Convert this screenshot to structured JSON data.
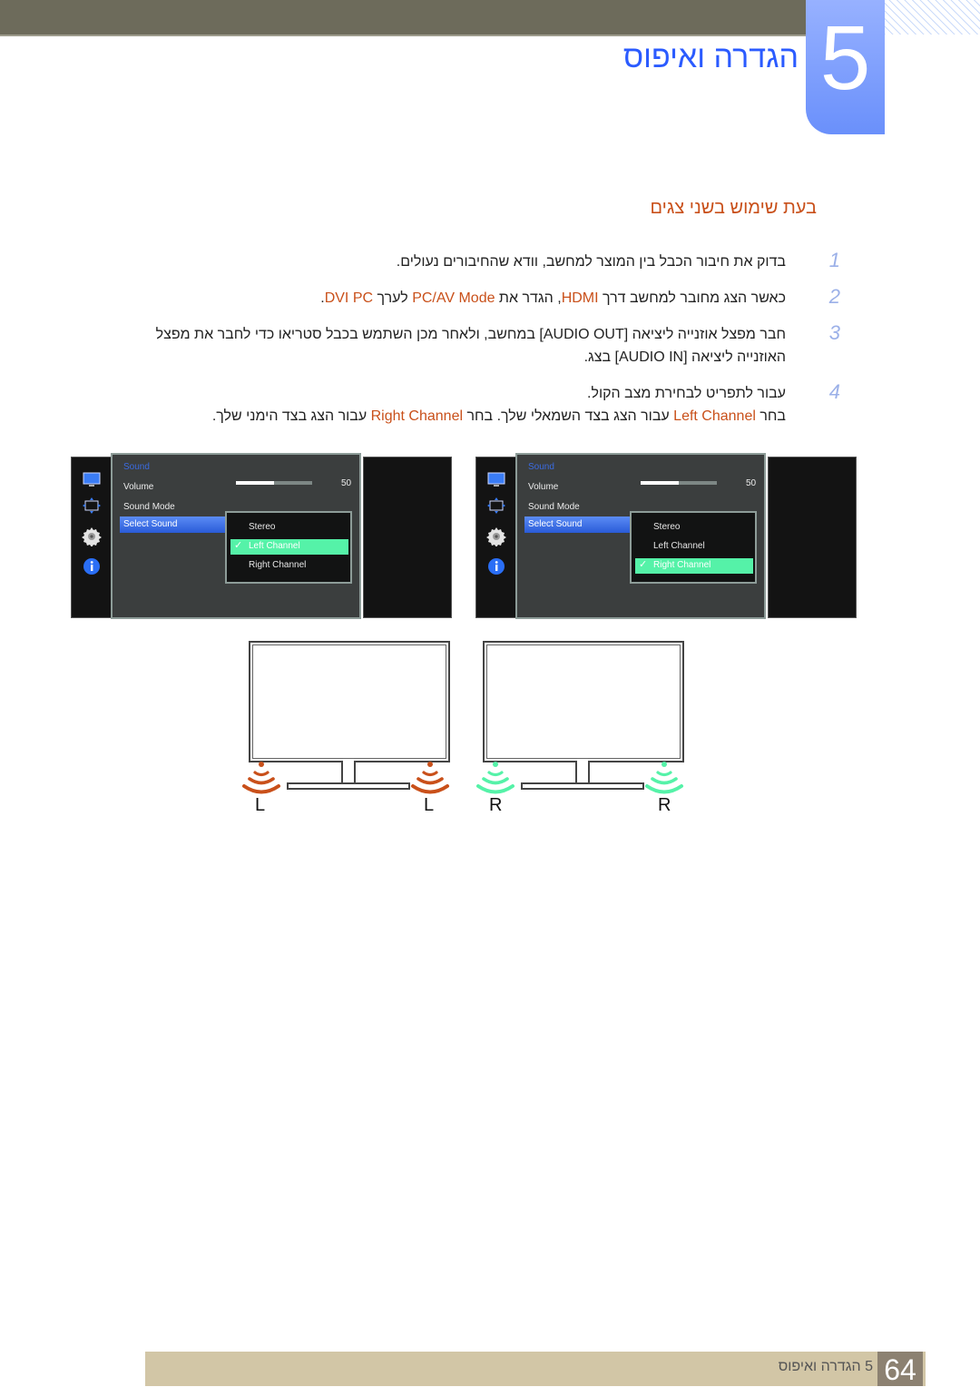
{
  "header": {
    "chapter_number": "5",
    "chapter_title": "הגדרה ואיפוס"
  },
  "section": {
    "title": "בעת שימוש בשני צגים"
  },
  "steps": [
    {
      "num": "1",
      "text": "בדוק את חיבור הכבל בין המוצר למחשב, וודא שהחיבורים נעולים."
    },
    {
      "num": "2",
      "parts": [
        "כאשר הצג מחובר למחשב דרך ",
        "HDMI",
        ", הגדר את ",
        "PC/AV Mode",
        " לערך ",
        "DVI PC",
        "."
      ]
    },
    {
      "num": "3",
      "text": "חבר מפצל אוזנייה ליציאה [AUDIO OUT] במחשב, ולאחר מכן השתמש בכבל סטריאו כדי לחבר את מפצל האוזנייה ליציאה [AUDIO IN] בצג."
    },
    {
      "num": "4",
      "line1": "עבור לתפריט לבחירת מצב הקול.",
      "parts": [
        "בחר ",
        "Left Channel",
        " עבור הצג בצד השמאלי שלך. בחר ",
        "Right Channel",
        " עבור הצג בצד הימני שלך."
      ]
    }
  ],
  "osd_menus": [
    {
      "category": "Sound",
      "items": [
        "Volume",
        "Sound Mode",
        "Select Sound"
      ],
      "selected_item": "Select Sound",
      "volume_value": "50",
      "volume_fraction": 0.5,
      "options": [
        "Stereo",
        "Left Channel",
        "Right Channel"
      ],
      "checked_option": "Left Channel",
      "check_icon": "✓"
    },
    {
      "category": "Sound",
      "items": [
        "Volume",
        "Sound Mode",
        "Select Sound"
      ],
      "selected_item": "Select Sound",
      "volume_value": "50",
      "volume_fraction": 0.5,
      "options": [
        "Stereo",
        "Left Channel",
        "Right Channel"
      ],
      "checked_option": "Right Channel",
      "check_icon": "✓"
    }
  ],
  "monitors": [
    {
      "speaker_labels": [
        "L",
        "L"
      ],
      "speaker_color": "#c9501a"
    },
    {
      "speaker_labels": [
        "R",
        "R"
      ],
      "speaker_color": "#55f2a8"
    }
  ],
  "footer": {
    "chapter_label": "5 הגדרה ואיפוס",
    "page_number": "64"
  }
}
